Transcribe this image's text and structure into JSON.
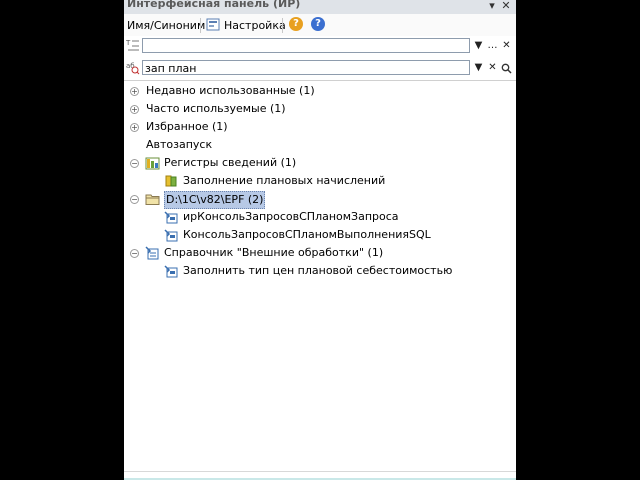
{
  "window": {
    "title": "Интерфейсная панель (ИР)",
    "menu_glyph": "▾",
    "close_glyph": "✕"
  },
  "toolbar": {
    "name_synonym_label": "Имя/Синоним",
    "settings_label": "Настройка",
    "help_glyph": "?",
    "info_glyph": "?"
  },
  "filter1": {
    "value": "",
    "dropdown_glyph": "▼",
    "select_glyph": "…",
    "clear_glyph": "✕"
  },
  "filter2": {
    "value": "зап план",
    "dropdown_glyph": "▼",
    "clear_glyph": "✕",
    "search_glyph": "⌕"
  },
  "tree": {
    "recent": "Недавно использованные (1)",
    "frequent": "Часто используемые (1)",
    "favorites": "Избранное (1)",
    "autostart": "Автозапуск",
    "registers": "Регистры сведений (1)",
    "registers_item": "Заполнение плановых начислений",
    "folder": "D:\\1C\\v82\\EPF (2)",
    "folder_item1": "ирКонсольЗапросовСПланомЗапроса",
    "folder_item2": "КонсольЗапросовСПланомВыполненияSQL",
    "catalog": "Справочник \"Внешние обработки\" (1)",
    "catalog_item": "Заполнить тип цен плановой себестоимостью",
    "plus": "+",
    "minus": "−"
  },
  "colors": {
    "selection": "#b7c9e6",
    "help_icon": "#e8a020",
    "info_icon": "#3b6fd0",
    "title_text": "#5a5a5a"
  }
}
